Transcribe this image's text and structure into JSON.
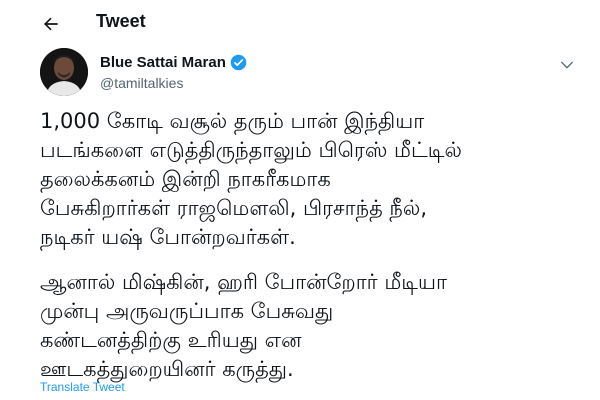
{
  "header": {
    "title": "Tweet",
    "back_icon": "arrow-left-icon"
  },
  "author": {
    "name": "Blue Sattai Maran",
    "handle": "@tamiltalkies",
    "verified_icon": "verified-badge-icon",
    "verified_color": "#1d9bf0",
    "more_icon": "chevron-down-icon"
  },
  "tweet": {
    "paragraphs": [
      "1,000 கோடி வசூல் தரும் பான் இந்தியா\nபடங்களை எடுத்திருந்தாலும் பிரெஸ் மீட்டில்\nதலைக்கனம் இன்றி நாகரீகமாக\nபேசுகிறார்கள் ராஜமௌலி, பிரசாந்த் நீல்,\nநடிகர் யஷ் போன்றவர்கள்.",
      "ஆனால் மிஷ்கின், ஹரி போன்றோர் மீடியா\nமுன்பு அருவருப்பாக பேசுவது\nகண்டனத்திற்கு உரியது என\nஊடகத்துறையினர் கருத்து."
    ]
  },
  "actions": {
    "translate_label": "Translate Tweet"
  },
  "colors": {
    "text": "#0f1419",
    "secondary": "#536471",
    "link": "#1d9bf0"
  }
}
